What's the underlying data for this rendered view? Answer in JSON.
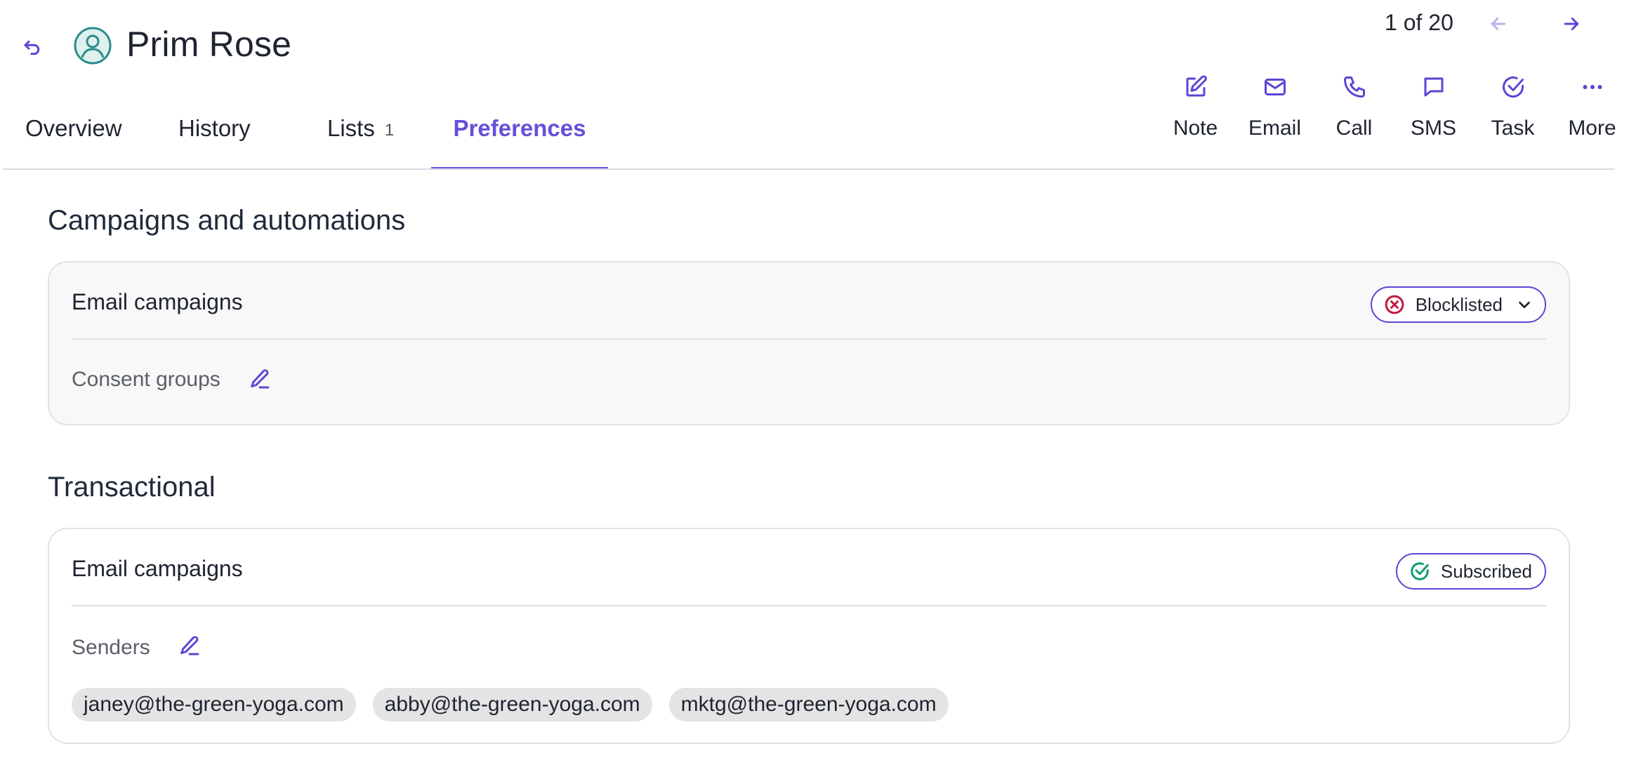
{
  "header": {
    "contact_name": "Prim Rose",
    "pager": "1 of 20"
  },
  "tabs": [
    {
      "label": "Overview"
    },
    {
      "label": "History"
    },
    {
      "label": "Lists",
      "count": "1"
    },
    {
      "label": "Preferences",
      "active": true
    }
  ],
  "actions": [
    {
      "label": "Note",
      "icon": "note-edit-icon"
    },
    {
      "label": "Email",
      "icon": "mail-icon"
    },
    {
      "label": "Call",
      "icon": "phone-icon"
    },
    {
      "label": "SMS",
      "icon": "message-icon"
    },
    {
      "label": "Task",
      "icon": "task-check-icon"
    },
    {
      "label": "More",
      "icon": "more-dots-icon"
    }
  ],
  "sections": {
    "campaigns": {
      "title": "Campaigns and automations",
      "card_title": "Email campaigns",
      "status": "Blocklisted",
      "status_color": "#c4183c",
      "sub_label": "Consent groups"
    },
    "transactional": {
      "title": "Transactional",
      "card_title": "Email campaigns",
      "status": "Subscribed",
      "status_color": "#0f9e6e",
      "sub_label": "Senders",
      "senders": [
        "janey@the-green-yoga.com",
        "abby@the-green-yoga.com",
        "mktg@the-green-yoga.com"
      ]
    }
  },
  "colors": {
    "accent": "#6450dc",
    "avatar": "#2a8c88",
    "card_bg": "#f8f8f8",
    "chip_bg": "#e4e4e4"
  }
}
